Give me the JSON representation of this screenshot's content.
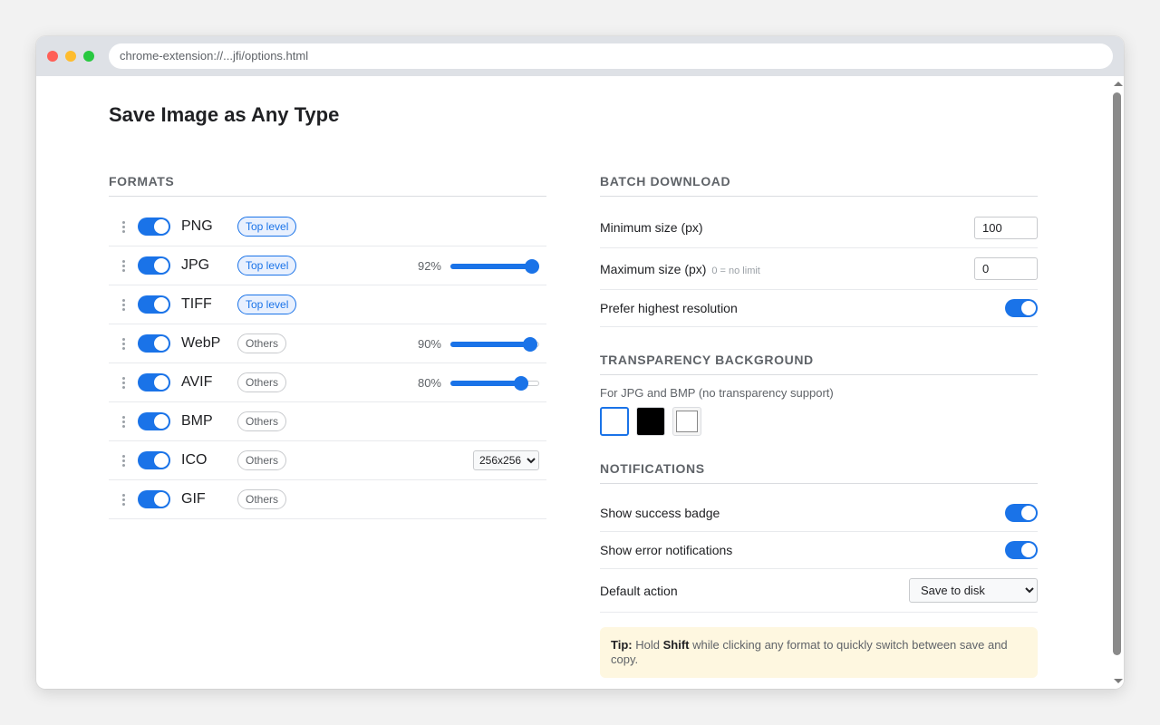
{
  "window": {
    "url": "chrome-extension://...jfi/options.html"
  },
  "page": {
    "title": "Save Image as Any Type"
  },
  "formats": {
    "heading": "FORMATS",
    "items": [
      {
        "name": "PNG",
        "enabled": true,
        "group": "Top level"
      },
      {
        "name": "JPG",
        "enabled": true,
        "group": "Top level",
        "quality_label": "92%",
        "quality": 92
      },
      {
        "name": "TIFF",
        "enabled": true,
        "group": "Top level"
      },
      {
        "name": "WebP",
        "enabled": true,
        "group": "Others",
        "quality_label": "90%",
        "quality": 90
      },
      {
        "name": "AVIF",
        "enabled": true,
        "group": "Others",
        "quality_label": "80%",
        "quality": 80
      },
      {
        "name": "BMP",
        "enabled": true,
        "group": "Others"
      },
      {
        "name": "ICO",
        "enabled": true,
        "group": "Others",
        "size_option": "256x256"
      },
      {
        "name": "GIF",
        "enabled": true,
        "group": "Others"
      }
    ]
  },
  "batch": {
    "heading": "BATCH DOWNLOAD",
    "min_label": "Minimum size (px)",
    "min_value": "100",
    "max_label": "Maximum size (px)",
    "max_hint": "0 = no limit",
    "max_value": "0",
    "prefer_label": "Prefer highest resolution",
    "prefer_enabled": true
  },
  "transparency": {
    "heading": "TRANSPARENCY BACKGROUND",
    "description": "For JPG and BMP (no transparency support)",
    "options": [
      "white",
      "black",
      "checker"
    ],
    "selected": "white"
  },
  "notifications": {
    "heading": "NOTIFICATIONS",
    "success_label": "Show success badge",
    "success_enabled": true,
    "error_label": "Show error notifications",
    "error_enabled": true,
    "default_action_label": "Default action",
    "default_action_value": "Save to disk"
  },
  "tip": {
    "label": "Tip:",
    "text_1": "Hold",
    "key": "Shift",
    "text_2": "while clicking any format to quickly switch between save and copy."
  },
  "colors": {
    "accent": "#1a73e8",
    "tip_bg": "#fef7e0"
  }
}
